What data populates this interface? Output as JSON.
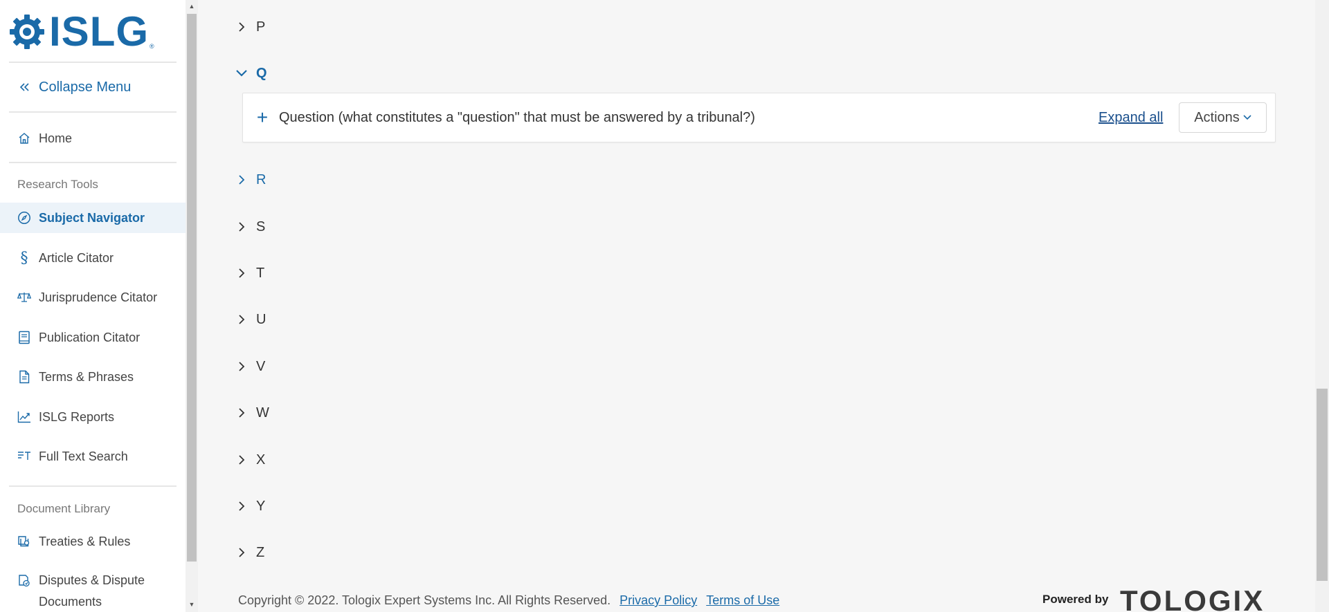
{
  "brand": {
    "name": "ISLG",
    "reg": "®"
  },
  "sidebar": {
    "collapse_label": "Collapse Menu",
    "home_label": "Home",
    "research_tools_heading": "Research Tools",
    "research_items": [
      {
        "label": "Subject Navigator",
        "icon": "compass-icon",
        "active": true
      },
      {
        "label": "Article Citator",
        "icon": "section-icon"
      },
      {
        "label": "Jurisprudence Citator",
        "icon": "scales-icon"
      },
      {
        "label": "Publication Citator",
        "icon": "book-icon"
      },
      {
        "label": "Terms & Phrases",
        "icon": "document-icon"
      },
      {
        "label": "ISLG Reports",
        "icon": "chart-line-icon"
      },
      {
        "label": "Full Text Search",
        "icon": "text-search-icon"
      }
    ],
    "document_library_heading": "Document Library",
    "library_items": [
      {
        "label": "Treaties & Rules",
        "icon": "treaties-icon"
      },
      {
        "label": "Disputes & Dispute",
        "label2": "Documents",
        "icon": "disputes-icon"
      }
    ]
  },
  "main": {
    "letters": [
      "P",
      "Q",
      "R",
      "S",
      "T",
      "U",
      "V",
      "W",
      "X",
      "Y",
      "Z"
    ],
    "expanded_letter": "Q",
    "q_entry": {
      "text": "Question (what constitutes a \"question\" that must be answered by a tribunal?)",
      "expand_all": "Expand all",
      "actions": "Actions"
    }
  },
  "footer": {
    "copyright": "Copyright © 2022. Tologix Expert Systems Inc. All Rights Reserved.",
    "privacy": "Privacy Policy",
    "terms": "Terms of Use",
    "powered_by": "Powered by",
    "tologix": "TOLOGIX"
  },
  "colors": {
    "accent": "#1a6aa8",
    "active_bg": "#ecf3f9",
    "page_bg": "#f6f6f6"
  }
}
